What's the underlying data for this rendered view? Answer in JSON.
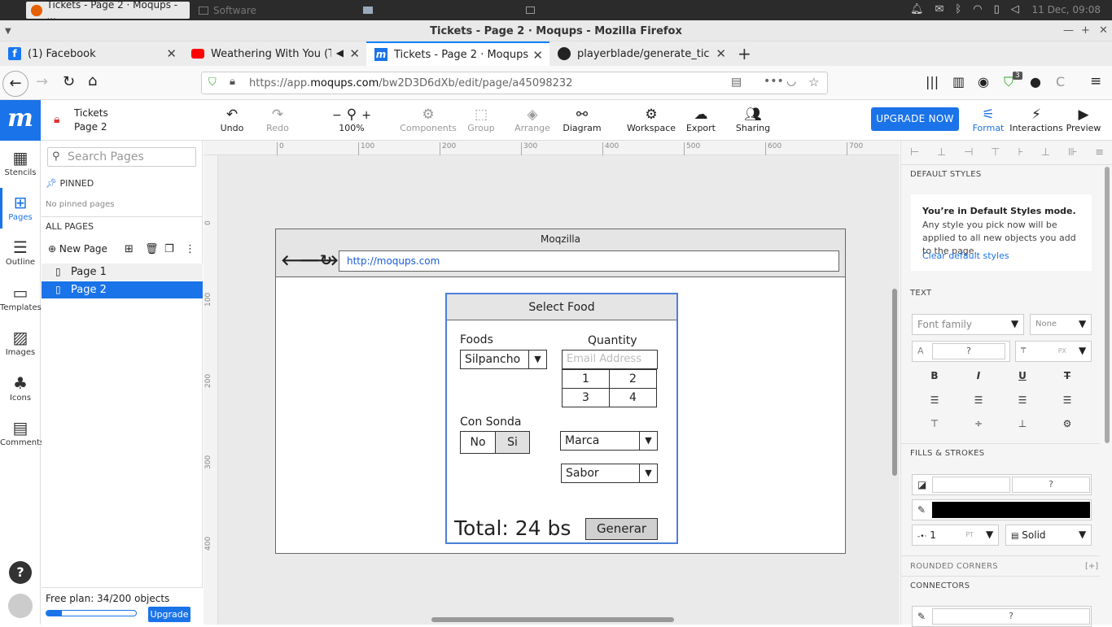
{
  "system_bar": {
    "tasks": [
      "Tickets - Page 2 · Moqups - ...",
      "Software",
      "",
      ""
    ],
    "clock": "11 Dec, 09:08"
  },
  "window": {
    "title": "Tickets - Page 2 · Moqups - Mozilla Firefox"
  },
  "browser_tabs": [
    {
      "label": "(1) Facebook"
    },
    {
      "label": "Weathering With You (Tenk"
    },
    {
      "label": "Tickets - Page 2 · Moqups"
    },
    {
      "label": "playerblade/generate_tickets"
    }
  ],
  "address_bar": {
    "url_prefix": "https://app.",
    "url_domain": "moqups.com",
    "url_rest": "/bw2D3D6dXb/edit/page/a45098232",
    "extension_badge": "3"
  },
  "moqups_toolbar": {
    "logo": "m",
    "project_title": "Tickets",
    "page_name": "Page 2",
    "undo": "Undo",
    "redo": "Redo",
    "zoom_minus": "−",
    "zoom_plus": "+",
    "zoom": "100%",
    "components": "Components",
    "group": "Group",
    "arrange": "Arrange",
    "diagram": "Diagram",
    "workspace": "Workspace",
    "export": "Export",
    "sharing": "Sharing",
    "upgrade_now": "UPGRADE NOW",
    "format": "Format",
    "interactions": "Interactions",
    "preview": "Preview"
  },
  "rail": {
    "stencils": "Stencils",
    "pages": "Pages",
    "outline": "Outline",
    "templates": "Templates",
    "images": "Images",
    "icons": "Icons",
    "comments": "Comments",
    "help": "?"
  },
  "pages_panel": {
    "search_placeholder": "Search Pages",
    "pinned": "PINNED",
    "no_pinned": "No pinned pages",
    "all_pages": "ALL PAGES",
    "new_page": "New Page",
    "pages": [
      "Page 1",
      "Page 2"
    ],
    "selected": "Page 2"
  },
  "plan": {
    "text": "Free plan: 34/200 objects",
    "used": 34,
    "total": 200,
    "upgrade": "Upgrade"
  },
  "ruler": {
    "top_ticks": [
      "0",
      "100",
      "200",
      "300",
      "400",
      "500",
      "600",
      "700"
    ],
    "left_ticks": [
      "0",
      "100",
      "200",
      "300",
      "400"
    ]
  },
  "mockup": {
    "browser_title": "Moqzilla",
    "url": "http://moqups.com",
    "dialog_title": "Select Food",
    "foods_label": "Foods",
    "foods_value": "Silpancho",
    "quantity_label": "Quantity",
    "quantity_placeholder": "Email Address",
    "quantity_grid": [
      "1",
      "2",
      "3",
      "4"
    ],
    "con_sonda_label": "Con Sonda",
    "no": "No",
    "si": "Si",
    "marca": "Marca",
    "sabor": "Sabor",
    "total": "Total: 24 bs",
    "generar": "Generar"
  },
  "right_panel": {
    "default_styles": "DEFAULT STYLES",
    "mode_title": "You’re in Default Styles mode.",
    "mode_desc": "Any style you pick now will be applied to all new objects you add to the page.",
    "clear_link": "Clear default styles",
    "text_section": "TEXT",
    "font_family_placeholder": "Font family",
    "font_weight": "None",
    "font_size": "?",
    "font_size_prefix": "A",
    "line_height_unit": "PX",
    "fills_strokes": "FILLS & STROKES",
    "fill_value": "?",
    "stroke_color": "#000000",
    "stroke_width": "1",
    "stroke_unit": "PT",
    "stroke_style": "Solid",
    "rounded_corners": "ROUNDED CORNERS",
    "rounded_add": "[+]",
    "connectors": "CONNECTORS",
    "connector_value": "?"
  },
  "colors": {
    "accent": "#1a73e8",
    "dialog_border": "#4a7fd8",
    "selected_page": "#1a73e8"
  }
}
